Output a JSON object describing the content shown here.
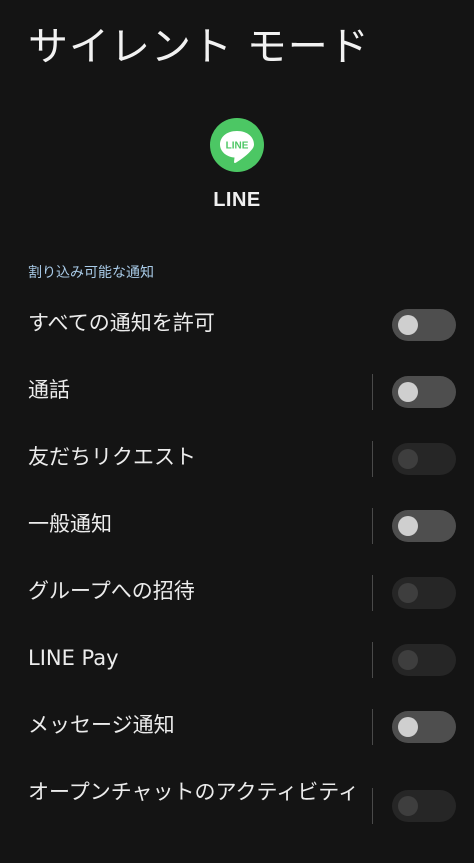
{
  "header": {
    "title": "サイレント モード"
  },
  "app": {
    "name": "LINE",
    "icon": "line-logo-icon",
    "icon_text": "LINE",
    "brand_color": "#4cc764"
  },
  "section": {
    "title": "割り込み可能な通知"
  },
  "settings": [
    {
      "label": "すべての通知を許可",
      "on": false,
      "enabled": true
    },
    {
      "label": "通話",
      "on": false,
      "enabled": true
    },
    {
      "label": "友だちリクエスト",
      "on": false,
      "enabled": false
    },
    {
      "label": "一般通知",
      "on": false,
      "enabled": true
    },
    {
      "label": "グループへの招待",
      "on": false,
      "enabled": false
    },
    {
      "label": "LINE Pay",
      "on": false,
      "enabled": false
    },
    {
      "label": "メッセージ通知",
      "on": false,
      "enabled": true
    },
    {
      "label": "オープンチャットのアクティビティ",
      "on": false,
      "enabled": false
    }
  ]
}
